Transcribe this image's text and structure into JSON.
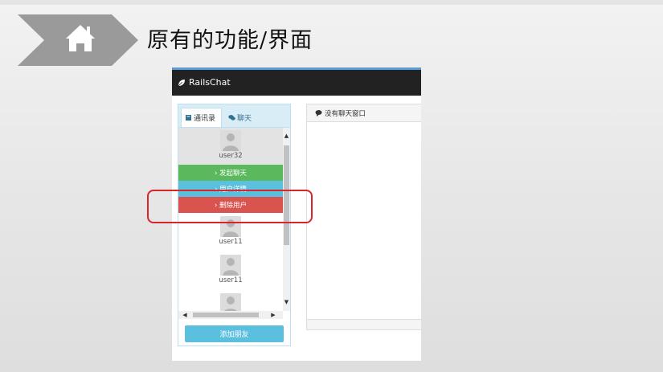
{
  "slide": {
    "title": "原有的功能/界面",
    "home_icon": "home-icon",
    "accent_color": "#9a9a9a"
  },
  "app": {
    "brand": "RailsChat",
    "brand_icon": "leaf-icon",
    "tabs": [
      {
        "label": "通讯录",
        "icon": "book-icon",
        "active": true
      },
      {
        "label": "聊天",
        "icon": "comments-icon",
        "active": false
      }
    ],
    "users": [
      {
        "name": "user32"
      },
      {
        "name": "user11"
      },
      {
        "name": "user11"
      }
    ],
    "actions": [
      {
        "label": "› 发起聊天",
        "color": "#5cb85c"
      },
      {
        "label": "› 用户详情",
        "color": "#5bc0de"
      },
      {
        "label": "› 删除用户",
        "color": "#d9534f"
      }
    ],
    "add_friend_label": "添加朋友",
    "chat_panel_title": "没有聊天窗口",
    "chat_panel_icon": "comment-icon"
  },
  "annotation": {
    "highlight_color": "#d7262b"
  }
}
